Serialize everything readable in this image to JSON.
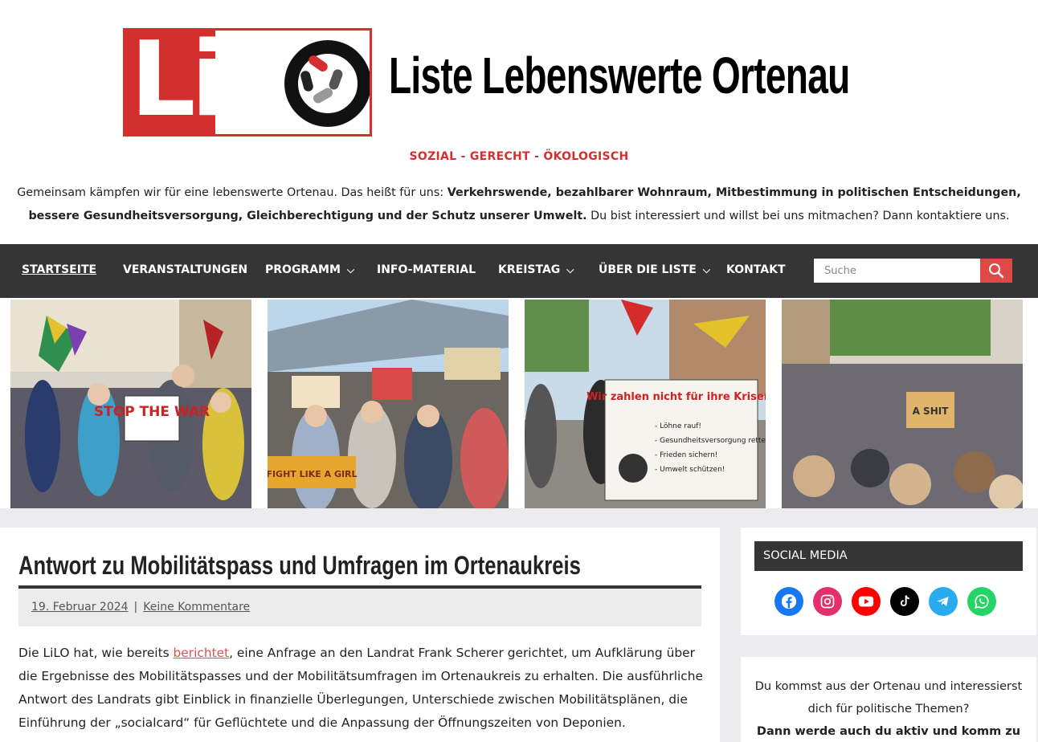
{
  "header": {
    "logo_text_a": "Li",
    "logo_text_b": "LO",
    "site_title": "Liste Lebenswerte Ortenau",
    "tagline": "SOZIAL - GERECHT - ÖKOLOGISCH",
    "intro_normal_1": "Gemeinsam kämpfen wir für eine lebenswerte Ortenau. Das heißt für uns: ",
    "intro_bold": "Verkehrswende, bezahlbarer Wohnraum, Mitbestimmung in politischen Entscheidungen, bessere Gesundheitsversorgung, Gleichberechtigung und der Schutz unserer Umwelt.",
    "intro_normal_2": " Du bist interessiert und willst bei uns mitmachen? Dann kontaktiere uns."
  },
  "nav": {
    "items": [
      {
        "label": "STARTSEITE",
        "active": true,
        "dropdown": false
      },
      {
        "label": "VERANSTALTUNGEN",
        "active": false,
        "dropdown": false
      },
      {
        "label": "PROGRAMM",
        "active": false,
        "dropdown": true
      },
      {
        "label": "INFO-MATERIAL",
        "active": false,
        "dropdown": false
      },
      {
        "label": "KREISTAG",
        "active": false,
        "dropdown": true
      },
      {
        "label": "ÜBER DIE LISTE",
        "active": false,
        "dropdown": true
      },
      {
        "label": "KONTAKT",
        "active": false,
        "dropdown": false
      }
    ],
    "search_placeholder": "Suche",
    "search_icon": "search-icon"
  },
  "banner": {
    "photo1_sign": "STOP THE WAR",
    "photo3_banner_title": "Wir zahlen nicht für ihre Krisen!",
    "photo3_banner_lines": [
      "- Löhne rauf!",
      "- Gesundheitsversorgung retten!",
      "- Frieden sichern!",
      "- Umwelt schützen!"
    ],
    "photo2_sign": "FIGHT LIKE A GIRL",
    "photo4_sign": "A SHIT"
  },
  "post": {
    "title": "Antwort zu Mobilitätspass und Umfragen im Ortenaukreis",
    "date": "19. Februar 2024",
    "separator": "|",
    "comments": "Keine Kommentare",
    "body_before_link": "Die LiLO hat, wie bereits ",
    "body_link": "berichtet",
    "body_after_link": ", eine Anfrage an den Landrat Frank Scherer gerichtet, um Aufklärung über die Ergebnisse des Mobilitätspasses und der Mobilitätsumfragen im Ortenaukreis zu erhalten. Die ausführliche Antwort des Landrats gibt Einblick in finanzielle Überlegungen, Unterschiede zwischen Mobilitätsplänen, die Einführung der „socialcard“ für Geflüchtete und die Anpassung der Öffnungszeiten von Deponien."
  },
  "sidebar": {
    "social_title": "SOCIAL MEDIA",
    "social_icons": [
      {
        "name": "facebook-icon",
        "color": "#1877f2"
      },
      {
        "name": "instagram-icon",
        "color": "#e1306c"
      },
      {
        "name": "youtube-icon",
        "color": "#ff0000"
      },
      {
        "name": "tiktok-icon",
        "color": "#000000"
      },
      {
        "name": "telegram-icon",
        "color": "#2aabee"
      },
      {
        "name": "whatsapp-icon",
        "color": "#25d366"
      }
    ],
    "cta_normal": "Du kommst aus der Ortenau und interessierst dich für politische Themen?",
    "cta_bold": "Dann werde auch du aktiv und komm zu"
  },
  "colors": {
    "accent": "#d32f2f",
    "nav_bg": "#353535",
    "search_button": "#e04848",
    "link": "#d9534f"
  }
}
